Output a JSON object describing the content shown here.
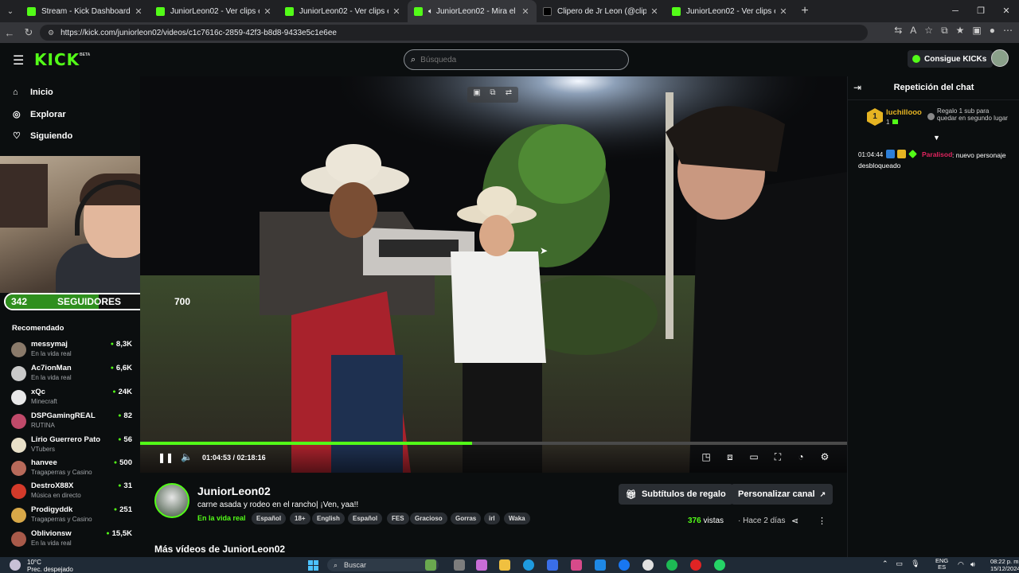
{
  "browser": {
    "tabs": [
      {
        "label": "Stream - Kick Dashboard",
        "icon": "kick"
      },
      {
        "label": "JuniorLeon02 - Ver clips en Kick",
        "icon": "kick"
      },
      {
        "label": "JuniorLeon02 - Ver clips en Kick",
        "icon": "kick"
      },
      {
        "label": "JuniorLeon02 - Mira el VOD en Kick",
        "icon": "kick",
        "active": true
      },
      {
        "label": "Clipero de Jr Leon (@clipsjuniorleon)",
        "icon": "tiktok"
      },
      {
        "label": "JuniorLeon02 - Ver clips en Kick",
        "icon": "kick"
      }
    ],
    "url": "https://kick.com/juniorleon02/videos/c1c7616c-2859-42f3-b8d8-9433e5c1e6ee"
  },
  "kick_nav": {
    "logo": "KICK",
    "logo_sup": "BETA",
    "search_placeholder": "Búsqueda",
    "get_kicks": "Consigue KICKs"
  },
  "sidebar": {
    "nav": [
      {
        "label": "Inicio",
        "icon": "home-icon"
      },
      {
        "label": "Explorar",
        "icon": "compass-icon"
      },
      {
        "label": "Siguiendo",
        "icon": "heart-icon"
      }
    ],
    "recommended_title": "Recomendado",
    "recommended": [
      {
        "name": "messymaj",
        "category": "En la vida real",
        "viewers": "8,3K",
        "color": "#8a7a6a"
      },
      {
        "name": "Ac7ionMan",
        "category": "En la vida real",
        "viewers": "6,6K",
        "color": "#c9c9c9"
      },
      {
        "name": "xQc",
        "category": "Minecraft",
        "viewers": "24K",
        "color": "#e8e8e8"
      },
      {
        "name": "DSPGamingREAL",
        "category": "RUTINA",
        "viewers": "82",
        "color": "#c04a6a"
      },
      {
        "name": "Lirio Guerrero Pato",
        "category": "VTubers",
        "viewers": "56",
        "color": "#e8e0c8"
      },
      {
        "name": "hanvee",
        "category": "Tragaperras y Casino",
        "viewers": "500",
        "color": "#b86a5a"
      },
      {
        "name": "DestroX88X",
        "category": "Música en directo",
        "viewers": "31",
        "color": "#d43a2a"
      },
      {
        "name": "Prodigyddk",
        "category": "Tragaperras y Casino",
        "viewers": "251",
        "color": "#d8a848"
      },
      {
        "name": "Oblivionsw",
        "category": "En la vida real",
        "viewers": "15,5K",
        "color": "#a85a4a"
      }
    ]
  },
  "overlay": {
    "followers_current": "342",
    "followers_label": "SEGUIDORES",
    "followers_goal": "700",
    "followers_progress": 0.49
  },
  "player": {
    "current_time": "01:04:53",
    "duration": "02:18:16",
    "progress": 0.47
  },
  "video": {
    "channel": "JuniorLeon02",
    "title": "carne asada y rodeo en el rancho| ¡Ven, yaa!!",
    "category": "En la vida real",
    "tags": [
      "Español",
      "18+",
      "English",
      "Español",
      "FES",
      "Gracioso",
      "Gorras",
      "irl",
      "Waka"
    ],
    "gift_subs_label": "Subtítulos de regalo",
    "customize_label": "Personalizar canal",
    "views": "376",
    "views_label": "vistas",
    "ago": "Hace 2 días",
    "more_videos": "Más vídeos de JuniorLeon02"
  },
  "chat": {
    "title": "Repetición del chat",
    "pinned_gift": {
      "user": "luchillooo",
      "count": "1",
      "badge": "1",
      "message": "Regalo 1 sub para quedar en segundo lugar"
    },
    "messages": [
      {
        "time": "01:04:44",
        "user": "Paralisod",
        "text": "nuevo personaje desbloqueado"
      }
    ]
  },
  "taskbar": {
    "temp": "10°C",
    "weather": "Prec. despejado",
    "search": "Buscar",
    "lang_top": "ENG",
    "lang_bottom": "ES",
    "time": "08:22 p. m.",
    "date": "15/12/2024"
  }
}
